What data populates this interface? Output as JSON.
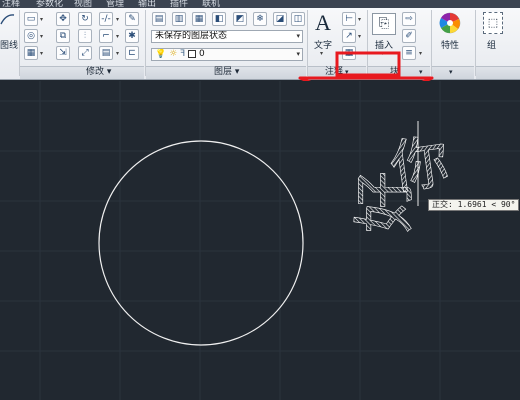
{
  "menubar": {
    "items": [
      "注释",
      "参数化",
      "视图",
      "管理",
      "输出",
      "插件",
      "联机"
    ]
  },
  "ribbon": {
    "panels": {
      "modify": {
        "title": "修改 ▾"
      },
      "layers": {
        "title": "图层 ▾",
        "layer_state": "未保存的图层状态",
        "current_layer": "0"
      },
      "annotation": {
        "title": "注释",
        "text_label": "文字",
        "title_dropdown": "▾"
      },
      "block": {
        "title": "块",
        "insert_label": "插入",
        "title_dropdown": "▾"
      },
      "properties": {
        "label": "特性",
        "title_dropdown": "▾"
      },
      "groups": {
        "label": "组"
      },
      "draw_partial": {
        "label": "图线"
      }
    }
  },
  "annotation_arrow": {
    "color": "#e8191f"
  },
  "canvas": {
    "background": "#212830",
    "tooltip": "正交: 1.6961 < 90°",
    "hatched_text_upper": "你",
    "hatched_text_lower": "好"
  }
}
